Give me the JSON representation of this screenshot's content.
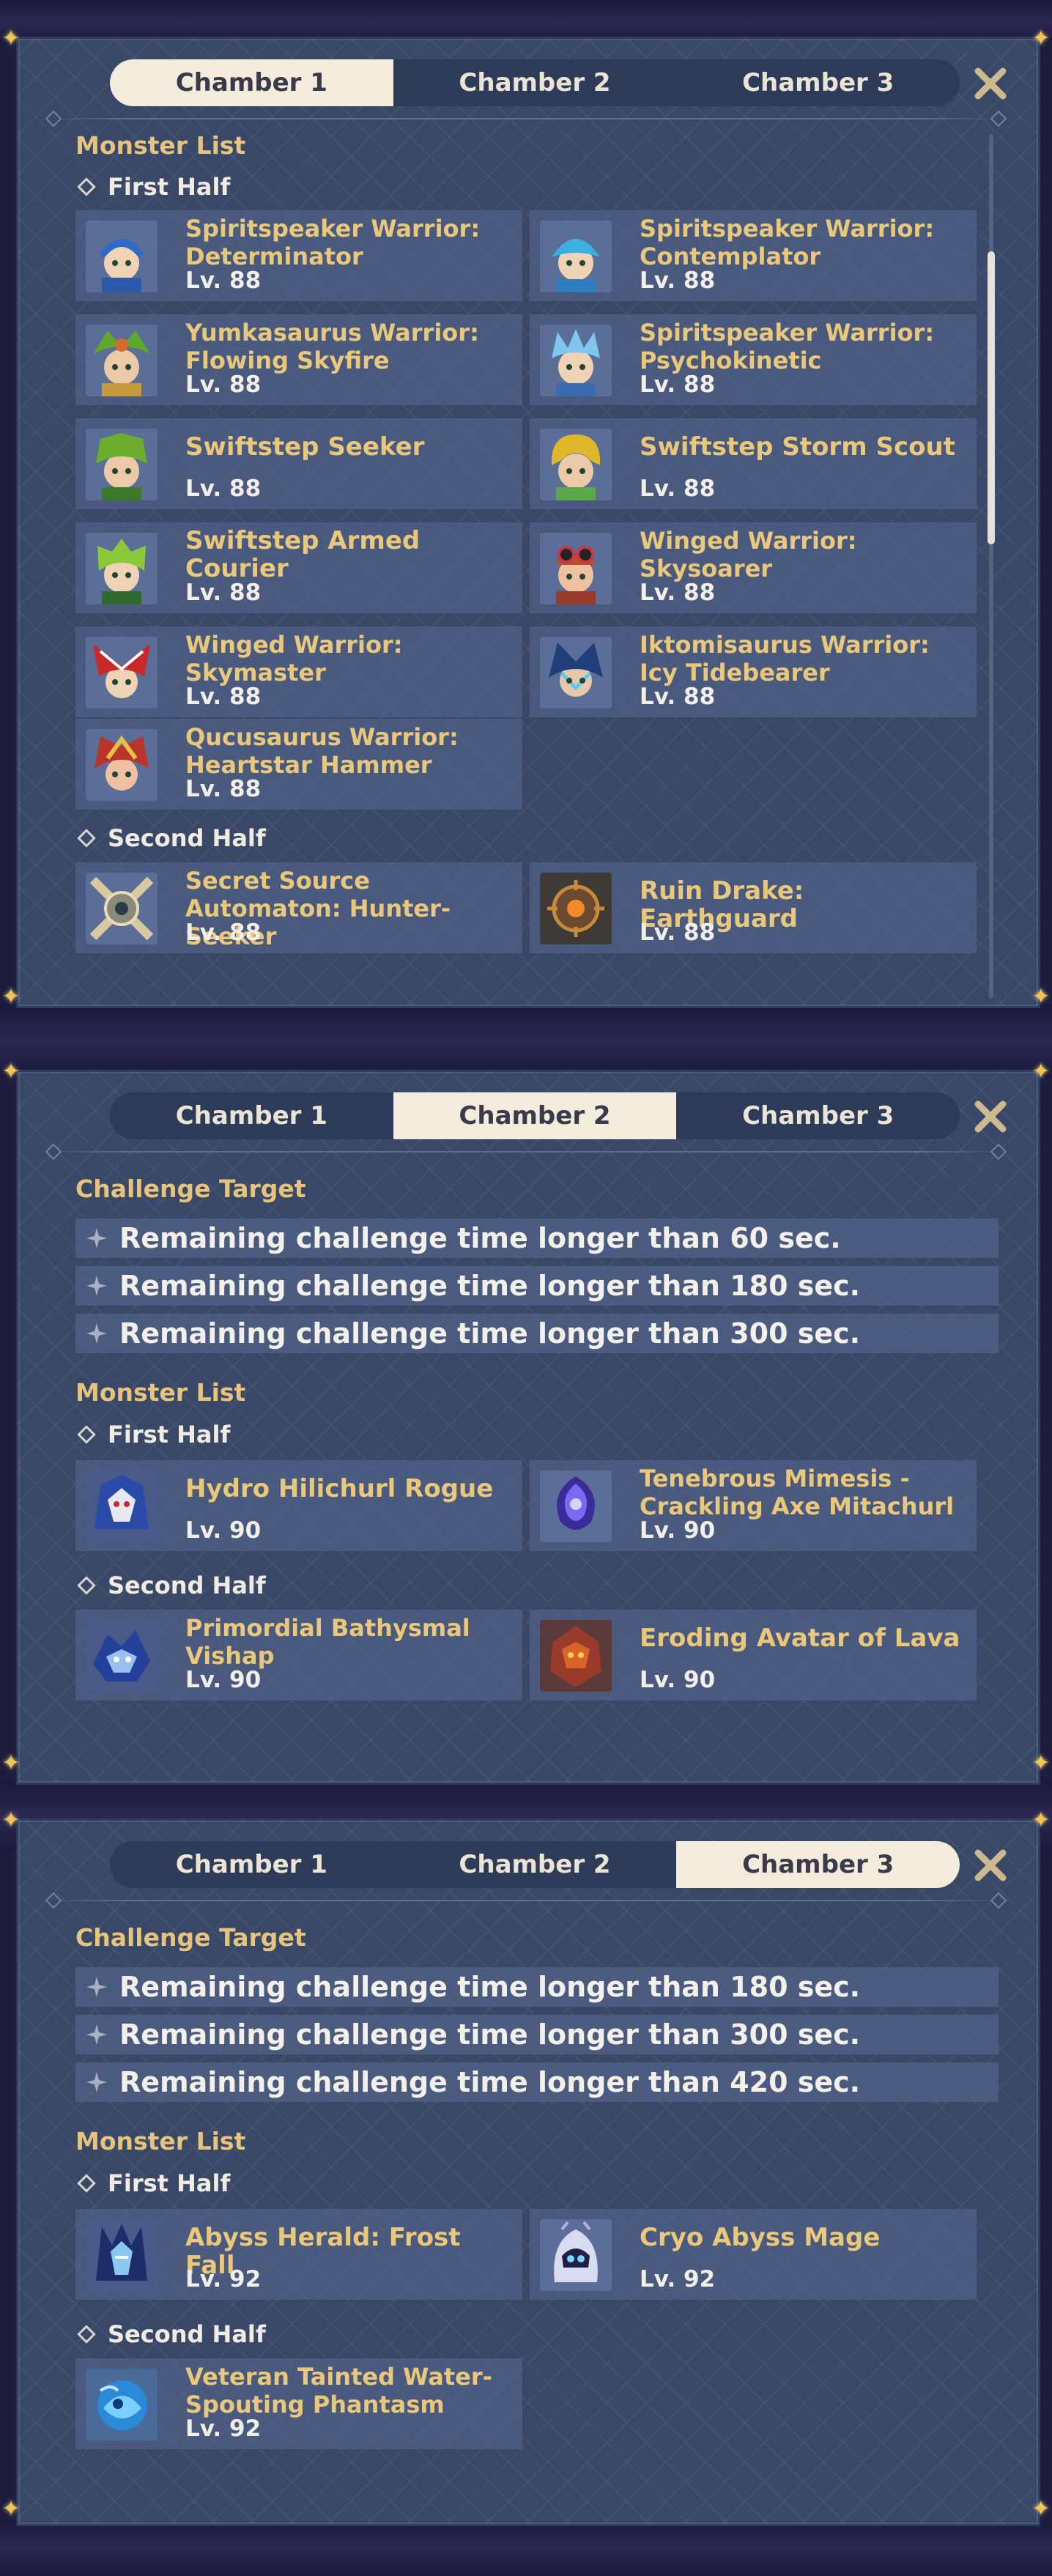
{
  "colors": {
    "accent_gold": "#e9c77b",
    "panel": "#3a4868",
    "tab_active": "#f3ecdc"
  },
  "tabs": [
    "Chamber 1",
    "Chamber 2",
    "Chamber 3"
  ],
  "labels": {
    "monster_list": "Monster List",
    "first_half": "First Half",
    "second_half": "Second Half",
    "challenge_target": "Challenge Target"
  },
  "panel1": {
    "active_tab": "Chamber 1",
    "first_half": [
      {
        "name": "Spiritspeaker Warrior: Determinator",
        "level": "Lv. 88",
        "icon": "blue-helmet-warrior-portrait"
      },
      {
        "name": "Spiritspeaker Warrior: Contemplator",
        "level": "Lv. 88",
        "icon": "blue-mask-warrior-portrait"
      },
      {
        "name": "Yumkasaurus Warrior: Flowing Skyfire",
        "level": "Lv. 88",
        "icon": "green-leaf-warrior-portrait"
      },
      {
        "name": "Spiritspeaker Warrior: Psychokinetic",
        "level": "Lv. 88",
        "icon": "ice-crown-warrior-portrait"
      },
      {
        "name": "Swiftstep Seeker",
        "level": "Lv. 88",
        "icon": "green-helmet-warrior-portrait"
      },
      {
        "name": "Swiftstep Storm Scout",
        "level": "Lv. 88",
        "icon": "yellow-helmet-warrior-portrait"
      },
      {
        "name": "Swiftstep Armed Courier",
        "level": "Lv. 88",
        "icon": "green-hair-warrior-portrait"
      },
      {
        "name": "Winged Warrior: Skysoarer",
        "level": "Lv. 88",
        "icon": "goggles-warrior-portrait"
      },
      {
        "name": "Winged Warrior: Skymaster",
        "level": "Lv. 88",
        "icon": "red-feather-warrior-portrait"
      },
      {
        "name": "Iktomisaurus Warrior: Icy Tidebearer",
        "level": "Lv. 88",
        "icon": "dark-blue-warrior-portrait"
      },
      {
        "name": "Qucusaurus Warrior: Heartstar Hammer",
        "level": "Lv. 88",
        "icon": "red-gold-warrior-portrait"
      }
    ],
    "second_half": [
      {
        "name": "Secret Source Automaton: Hunter-Seeker",
        "level": "Lv. 88",
        "icon": "automaton-portrait"
      },
      {
        "name": "Ruin Drake: Earthguard",
        "level": "Lv. 88",
        "icon": "ruin-drake-portrait"
      }
    ]
  },
  "panel2": {
    "active_tab": "Chamber 2",
    "targets": [
      "Remaining challenge time longer than 60 sec.",
      "Remaining challenge time longer than 180 sec.",
      "Remaining challenge time longer than 300 sec."
    ],
    "first_half": [
      {
        "name": "Hydro Hilichurl Rogue",
        "level": "Lv. 90",
        "icon": "hydro-rogue-portrait"
      },
      {
        "name": "Tenebrous Mimesis - Crackling Axe Mitachurl",
        "level": "Lv. 90",
        "icon": "tenebrous-mimesis-portrait"
      }
    ],
    "second_half": [
      {
        "name": "Primordial Bathysmal Vishap",
        "level": "Lv. 90",
        "icon": "vishap-portrait"
      },
      {
        "name": "Eroding Avatar of Lava",
        "level": "Lv. 90",
        "icon": "lava-avatar-portrait"
      }
    ]
  },
  "panel3": {
    "active_tab": "Chamber 3",
    "targets": [
      "Remaining challenge time longer than 180 sec.",
      "Remaining challenge time longer than 300 sec.",
      "Remaining challenge time longer than 420 sec."
    ],
    "first_half": [
      {
        "name": "Abyss Herald: Frost Fall",
        "level": "Lv. 92",
        "icon": "abyss-herald-portrait"
      },
      {
        "name": "Cryo Abyss Mage",
        "level": "Lv. 92",
        "icon": "cryo-mage-portrait"
      }
    ],
    "second_half": [
      {
        "name": "Veteran Tainted Water-Spouting Phantasm",
        "level": "Lv. 92",
        "icon": "phantasm-portrait"
      }
    ]
  }
}
